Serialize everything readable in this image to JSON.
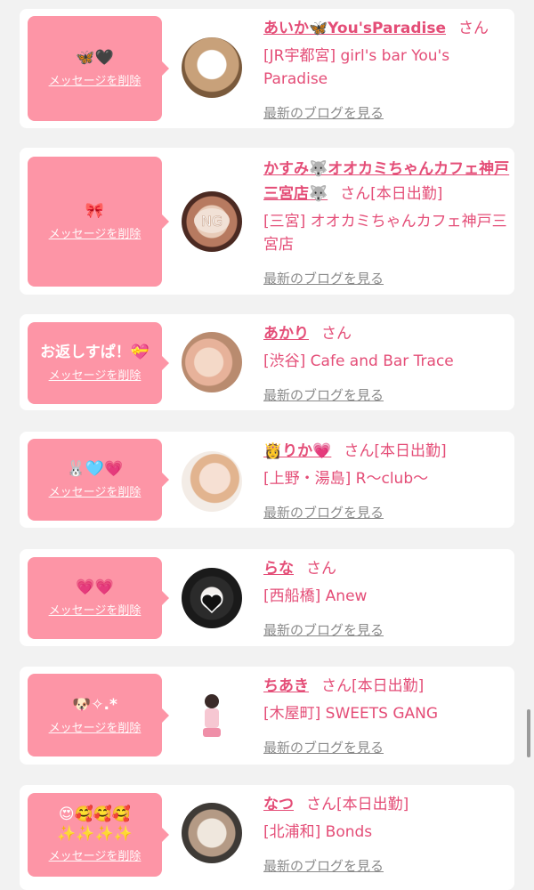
{
  "labels": {
    "delete": "メッセージを削除",
    "san": "さん",
    "today": "[本日出勤]",
    "blog": "最新のブログを見る"
  },
  "colors": {
    "page_bg": "#f2f2f2",
    "card_bg": "#ffffff",
    "bubble": "#fd95a6",
    "name_pink": "#e44d77",
    "link_gray": "#8a8a8a"
  },
  "items": [
    {
      "message": "🦋🖤",
      "name": "あいか🦋You'sParadise",
      "working_today": false,
      "shop": "[JR宇都宮] girl's bar You's Paradise"
    },
    {
      "message": "🎀",
      "name": "かすみ🐺オオカミちゃんカフェ神戸三宮店🐺",
      "working_today": true,
      "shop": "[三宮] オオカミちゃんカフェ神戸三宮店"
    },
    {
      "message": "お返しすぱ！💝",
      "name": "あかり",
      "working_today": false,
      "shop": "[渋谷] Cafe and Bar Trace"
    },
    {
      "message": "🐰🩵💗",
      "name": "👸りか💗",
      "working_today": true,
      "shop": "[上野・湯島] R〜club〜"
    },
    {
      "message": "💗💗",
      "name": "らな",
      "working_today": false,
      "shop": "[西船橋] Anew"
    },
    {
      "message": "🐶✧.*",
      "name": "ちあき",
      "working_today": true,
      "shop": "[木屋町] SWEETS GANG"
    },
    {
      "message": "😍🥰🥰🥰 ✨✨✨✨",
      "name": "なつ",
      "working_today": true,
      "shop": "[北浦和] Bonds"
    }
  ]
}
